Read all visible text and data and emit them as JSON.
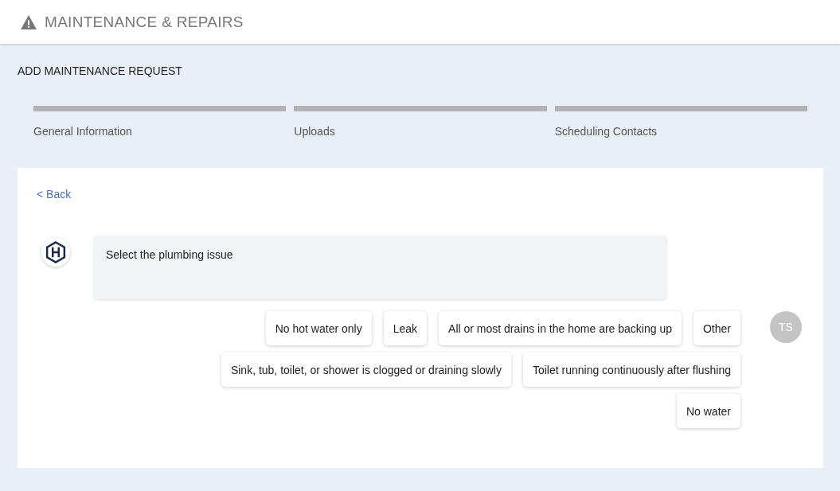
{
  "header": {
    "title": "MAINTENANCE & REPAIRS"
  },
  "page_title": "ADD MAINTENANCE REQUEST",
  "steps": [
    {
      "label": "General Information",
      "completed": false
    },
    {
      "label": "Uploads",
      "completed": false
    },
    {
      "label": "Scheduling Contacts",
      "completed": false
    }
  ],
  "card": {
    "back_link": "< Back",
    "message": "Select the plumbing issue",
    "user_initials": "TS",
    "option_rows": [
      [
        "No hot water only",
        "Leak",
        "All or most drains in the home are backing up",
        "Other"
      ],
      [
        "Sink, tub, toilet, or shower is clogged or draining slowly",
        "Toilet running continuously after flushing"
      ],
      [
        "No water"
      ]
    ]
  }
}
